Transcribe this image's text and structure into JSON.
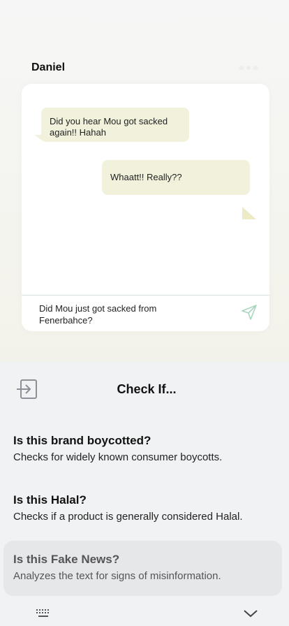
{
  "chat": {
    "contact_name": "Daniel",
    "messages": [
      {
        "direction": "incoming",
        "text": "Did you hear Mou got sacked again!! Hahah"
      },
      {
        "direction": "outgoing",
        "text": "Whaatt!! Really??"
      }
    ],
    "draft_message": "Did Mou just got sacked from Fenerbahce?",
    "send_icon": "send-icon",
    "accent_color": "#f2f2dc"
  },
  "sheet": {
    "title": "Check If...",
    "exit_icon": "exit-icon",
    "options": [
      {
        "title": "Is this brand boycotted?",
        "description": "Checks for widely known consumer boycotts."
      },
      {
        "title": "Is this Halal?",
        "description": "Checks if a product is generally considered Halal."
      },
      {
        "title": "Is this Fake News?",
        "description": "Analyzes the text for signs of misinformation.",
        "highlighted": true
      }
    ]
  },
  "nav": {
    "keyboard_icon": "keyboard-icon",
    "collapse_icon": "chevron-down-icon"
  }
}
